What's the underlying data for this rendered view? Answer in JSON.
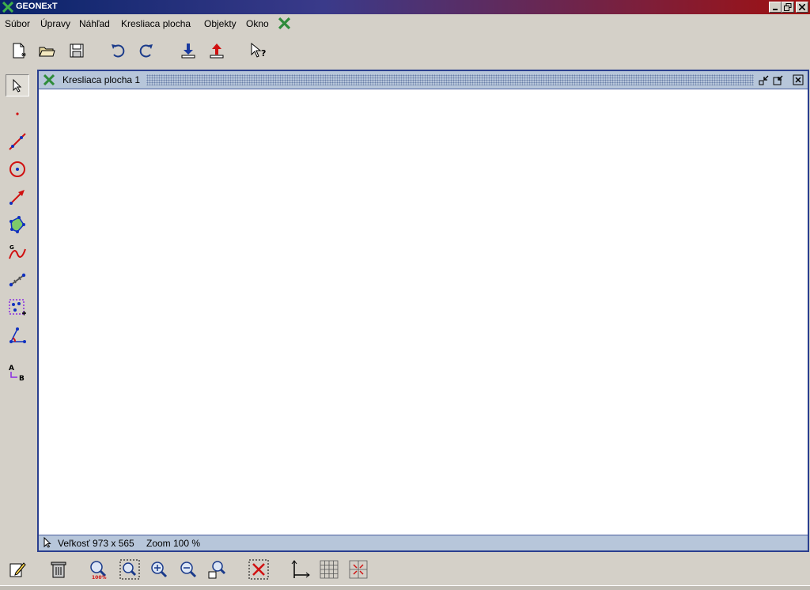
{
  "window": {
    "title": "GEONExT"
  },
  "menu": {
    "items": [
      "Súbor",
      "Úpravy",
      "Náhľad",
      "Kresliaca plocha",
      "Objekty",
      "Okno"
    ]
  },
  "internal": {
    "title": "Kresliaca plocha 1"
  },
  "status": {
    "size": "Veľkosť 973 x 565",
    "zoom": "Zoom 100 %"
  },
  "icons": {
    "toolbar": [
      "new-file-icon",
      "open-folder-icon",
      "save-disk-icon",
      "undo-icon",
      "redo-icon",
      "import-icon",
      "export-icon",
      "help-pointer-icon"
    ],
    "left": [
      "select-arrow-icon",
      "point-icon",
      "line-icon",
      "circle-icon",
      "vector-icon",
      "polygon-icon",
      "function-graph-icon",
      "measure-distance-icon",
      "point-group-icon",
      "angle-icon",
      "text-label-icon"
    ],
    "bottom": [
      "edit-properties-icon",
      "trash-icon",
      "zoom-100-icon",
      "zoom-fit-icon",
      "zoom-in-icon",
      "zoom-out-icon",
      "zoom-select-icon",
      "delete-all-icon",
      "axes-icon",
      "grid-icon",
      "snap-grid-icon"
    ]
  },
  "colors": {
    "accent": "#0a246a",
    "brand_green": "#2e8b3a",
    "point_red": "#d01010",
    "point_blue": "#1030c0"
  }
}
